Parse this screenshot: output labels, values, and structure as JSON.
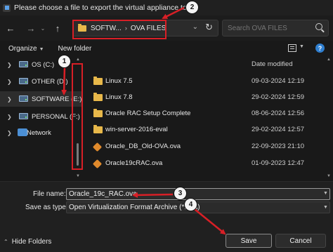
{
  "window": {
    "title": "Please choose a file to export the virtual appliance to"
  },
  "navbar": {
    "back_icon": "arrow-left-icon",
    "forward_icon": "arrow-right-icon",
    "recent_icon": "chevron-down-icon",
    "up_icon": "arrow-up-icon",
    "breadcrumb": [
      "SOFTW...",
      "OVA FILES"
    ],
    "refresh_icon": "refresh-icon",
    "search": {
      "placeholder": "Search OVA FILES",
      "value": ""
    }
  },
  "toolbar": {
    "organize_label": "Organize",
    "new_folder_label": "New folder",
    "view_icon": "details-view-icon",
    "help_icon": "help-icon"
  },
  "sidebar": {
    "items": [
      {
        "label": "OS (C:)",
        "icon": "drive-icon",
        "selected": false
      },
      {
        "label": "OTHER (D:)",
        "icon": "drive-icon",
        "selected": false
      },
      {
        "label": "SOFTWARE (E:)",
        "icon": "drive-icon",
        "selected": true
      },
      {
        "label": "PERSONAL (F:)",
        "icon": "drive-icon",
        "selected": false
      },
      {
        "label": "Network",
        "icon": "network-icon",
        "selected": false
      }
    ]
  },
  "file_list": {
    "date_header": "Date modified",
    "files": [
      {
        "name": "Linux 7.5",
        "date": "09-03-2024 12:19",
        "type": "folder"
      },
      {
        "name": "Linux 7.8",
        "date": "29-02-2024 12:59",
        "type": "folder"
      },
      {
        "name": "Oracle RAC Setup Complete",
        "date": "08-06-2024 12:56",
        "type": "folder"
      },
      {
        "name": "win-server-2016-eval",
        "date": "29-02-2024 12:57",
        "type": "folder"
      },
      {
        "name": "Oracle_DB_Old-OVA.ova",
        "date": "22-09-2023 21:10",
        "type": "ova"
      },
      {
        "name": "Oracle19cRAC.ova",
        "date": "01-09-2023 12:47",
        "type": "ova"
      }
    ]
  },
  "save_form": {
    "file_name_label": "File name:",
    "file_name_value": "Oracle_19c_RAC.ova",
    "save_as_type_label": "Save as type:",
    "save_as_type_value": "Open Virtualization Format Archive (*.ova)",
    "hide_folders_label": "Hide Folders",
    "save_label": "Save",
    "cancel_label": "Cancel"
  },
  "annotations": {
    "step_1": "1",
    "step_2": "2",
    "step_3": "3",
    "step_4": "4",
    "color": "#d81f26"
  }
}
